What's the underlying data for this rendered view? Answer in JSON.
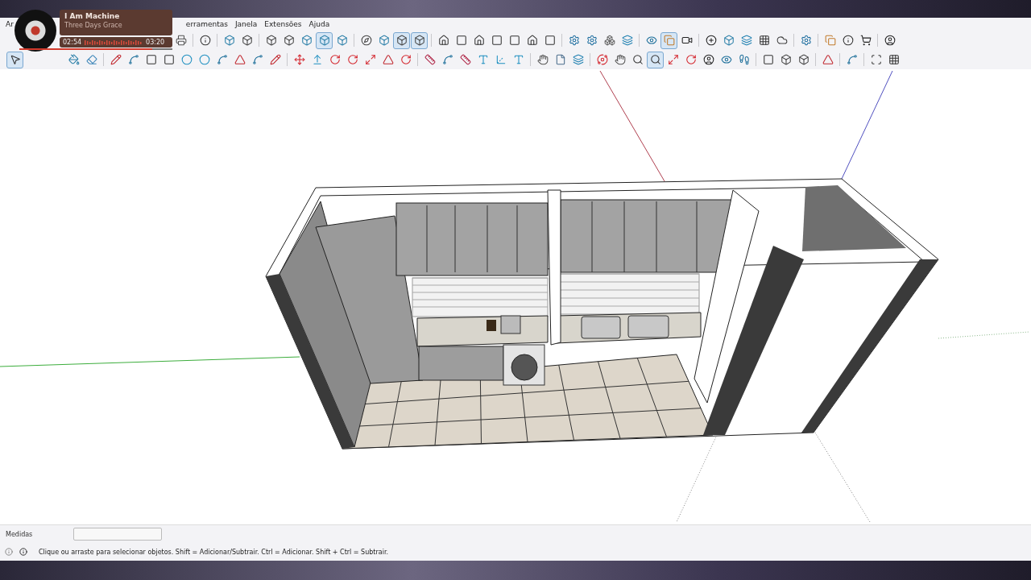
{
  "menu": [
    {
      "label": "Ar"
    },
    {
      "label": "erramentas"
    },
    {
      "label": "Janela"
    },
    {
      "label": "Extensões"
    },
    {
      "label": "Ajuda"
    }
  ],
  "player": {
    "title": "I Am Machine",
    "artist": "Three Days Grace",
    "elapsed": "02:54",
    "total": "03:20",
    "level": 0.87
  },
  "toolbar_1": [
    {
      "kind": "print",
      "selected": false
    },
    {
      "kind": "sep"
    },
    {
      "kind": "info",
      "selected": false
    },
    {
      "kind": "sep"
    },
    {
      "kind": "box",
      "selected": false
    },
    {
      "kind": "cube",
      "selected": false
    },
    {
      "kind": "sep"
    },
    {
      "kind": "cube",
      "selected": false
    },
    {
      "kind": "cube",
      "selected": false
    },
    {
      "kind": "box",
      "selected": false
    },
    {
      "kind": "box",
      "selected": true
    },
    {
      "kind": "box",
      "selected": false
    },
    {
      "kind": "sep"
    },
    {
      "kind": "compass",
      "selected": false
    },
    {
      "kind": "box",
      "selected": false
    },
    {
      "kind": "cube",
      "selected": true
    },
    {
      "kind": "cube",
      "selected": true
    },
    {
      "kind": "sep"
    },
    {
      "kind": "house",
      "selected": false
    },
    {
      "kind": "square",
      "selected": false
    },
    {
      "kind": "house",
      "selected": false
    },
    {
      "kind": "square",
      "selected": false
    },
    {
      "kind": "square",
      "selected": false
    },
    {
      "kind": "house",
      "selected": false
    },
    {
      "kind": "square",
      "selected": false
    },
    {
      "kind": "sep"
    },
    {
      "kind": "settings",
      "selected": false
    },
    {
      "kind": "settings",
      "selected": false
    },
    {
      "kind": "boxes",
      "selected": false
    },
    {
      "kind": "layers",
      "selected": false
    },
    {
      "kind": "sep"
    },
    {
      "kind": "eye",
      "selected": false
    },
    {
      "kind": "copy",
      "selected": true
    },
    {
      "kind": "video",
      "selected": false
    },
    {
      "kind": "sep"
    },
    {
      "kind": "plus",
      "selected": false
    },
    {
      "kind": "box",
      "selected": false
    },
    {
      "kind": "layers",
      "selected": false
    },
    {
      "kind": "grid",
      "selected": false
    },
    {
      "kind": "cloud",
      "selected": false
    },
    {
      "kind": "sep"
    },
    {
      "kind": "settings",
      "selected": false
    },
    {
      "kind": "sep"
    },
    {
      "kind": "copy",
      "selected": false
    },
    {
      "kind": "info",
      "selected": false
    },
    {
      "kind": "cart",
      "selected": false
    },
    {
      "kind": "sep"
    },
    {
      "kind": "user",
      "selected": false
    }
  ],
  "toolbar_2": [
    {
      "kind": "select",
      "selected": true
    },
    {
      "kind": "gap"
    },
    {
      "kind": "paint",
      "selected": false
    },
    {
      "kind": "eraser",
      "selected": false
    },
    {
      "kind": "sep"
    },
    {
      "kind": "pencil",
      "selected": false
    },
    {
      "kind": "spline",
      "selected": false
    },
    {
      "kind": "square",
      "selected": false
    },
    {
      "kind": "square",
      "selected": false
    },
    {
      "kind": "circle",
      "selected": false
    },
    {
      "kind": "circle",
      "selected": false
    },
    {
      "kind": "spline",
      "selected": false
    },
    {
      "kind": "triangle",
      "selected": false
    },
    {
      "kind": "spline",
      "selected": false
    },
    {
      "kind": "pencil",
      "selected": false
    },
    {
      "kind": "sep"
    },
    {
      "kind": "move",
      "selected": false
    },
    {
      "kind": "push",
      "selected": false
    },
    {
      "kind": "rotate",
      "selected": false
    },
    {
      "kind": "rotate",
      "selected": false
    },
    {
      "kind": "scale",
      "selected": false
    },
    {
      "kind": "triangle",
      "selected": false
    },
    {
      "kind": "rotate",
      "selected": false
    },
    {
      "kind": "sep"
    },
    {
      "kind": "tape",
      "selected": false
    },
    {
      "kind": "spline",
      "selected": false
    },
    {
      "kind": "tape",
      "selected": false
    },
    {
      "kind": "text",
      "selected": false
    },
    {
      "kind": "axes",
      "selected": false
    },
    {
      "kind": "text",
      "selected": false
    },
    {
      "kind": "sep"
    },
    {
      "kind": "hand",
      "selected": false
    },
    {
      "kind": "file",
      "selected": false
    },
    {
      "kind": "layers",
      "selected": false
    },
    {
      "kind": "sep"
    },
    {
      "kind": "orbit",
      "selected": false
    },
    {
      "kind": "hand",
      "selected": false
    },
    {
      "kind": "zoom",
      "selected": false
    },
    {
      "kind": "zoom",
      "selected": true
    },
    {
      "kind": "scale",
      "selected": false
    },
    {
      "kind": "rotate",
      "selected": false
    },
    {
      "kind": "user",
      "selected": false
    },
    {
      "kind": "eye",
      "selected": false
    },
    {
      "kind": "walk",
      "selected": false
    },
    {
      "kind": "sep"
    },
    {
      "kind": "square",
      "selected": false
    },
    {
      "kind": "cube",
      "selected": false
    },
    {
      "kind": "cube",
      "selected": false
    },
    {
      "kind": "sep"
    },
    {
      "kind": "triangle",
      "selected": false
    },
    {
      "kind": "sep"
    },
    {
      "kind": "spline",
      "selected": false
    },
    {
      "kind": "sep"
    },
    {
      "kind": "scan",
      "selected": false
    },
    {
      "kind": "grid",
      "selected": false
    }
  ],
  "measurements": {
    "label": "Medidas"
  },
  "status": {
    "hint": "Clique ou arraste para selecionar objetos. Shift = Adicionar/Subtrair. Ctrl = Adicionar. Shift + Ctrl = Subtrair."
  }
}
